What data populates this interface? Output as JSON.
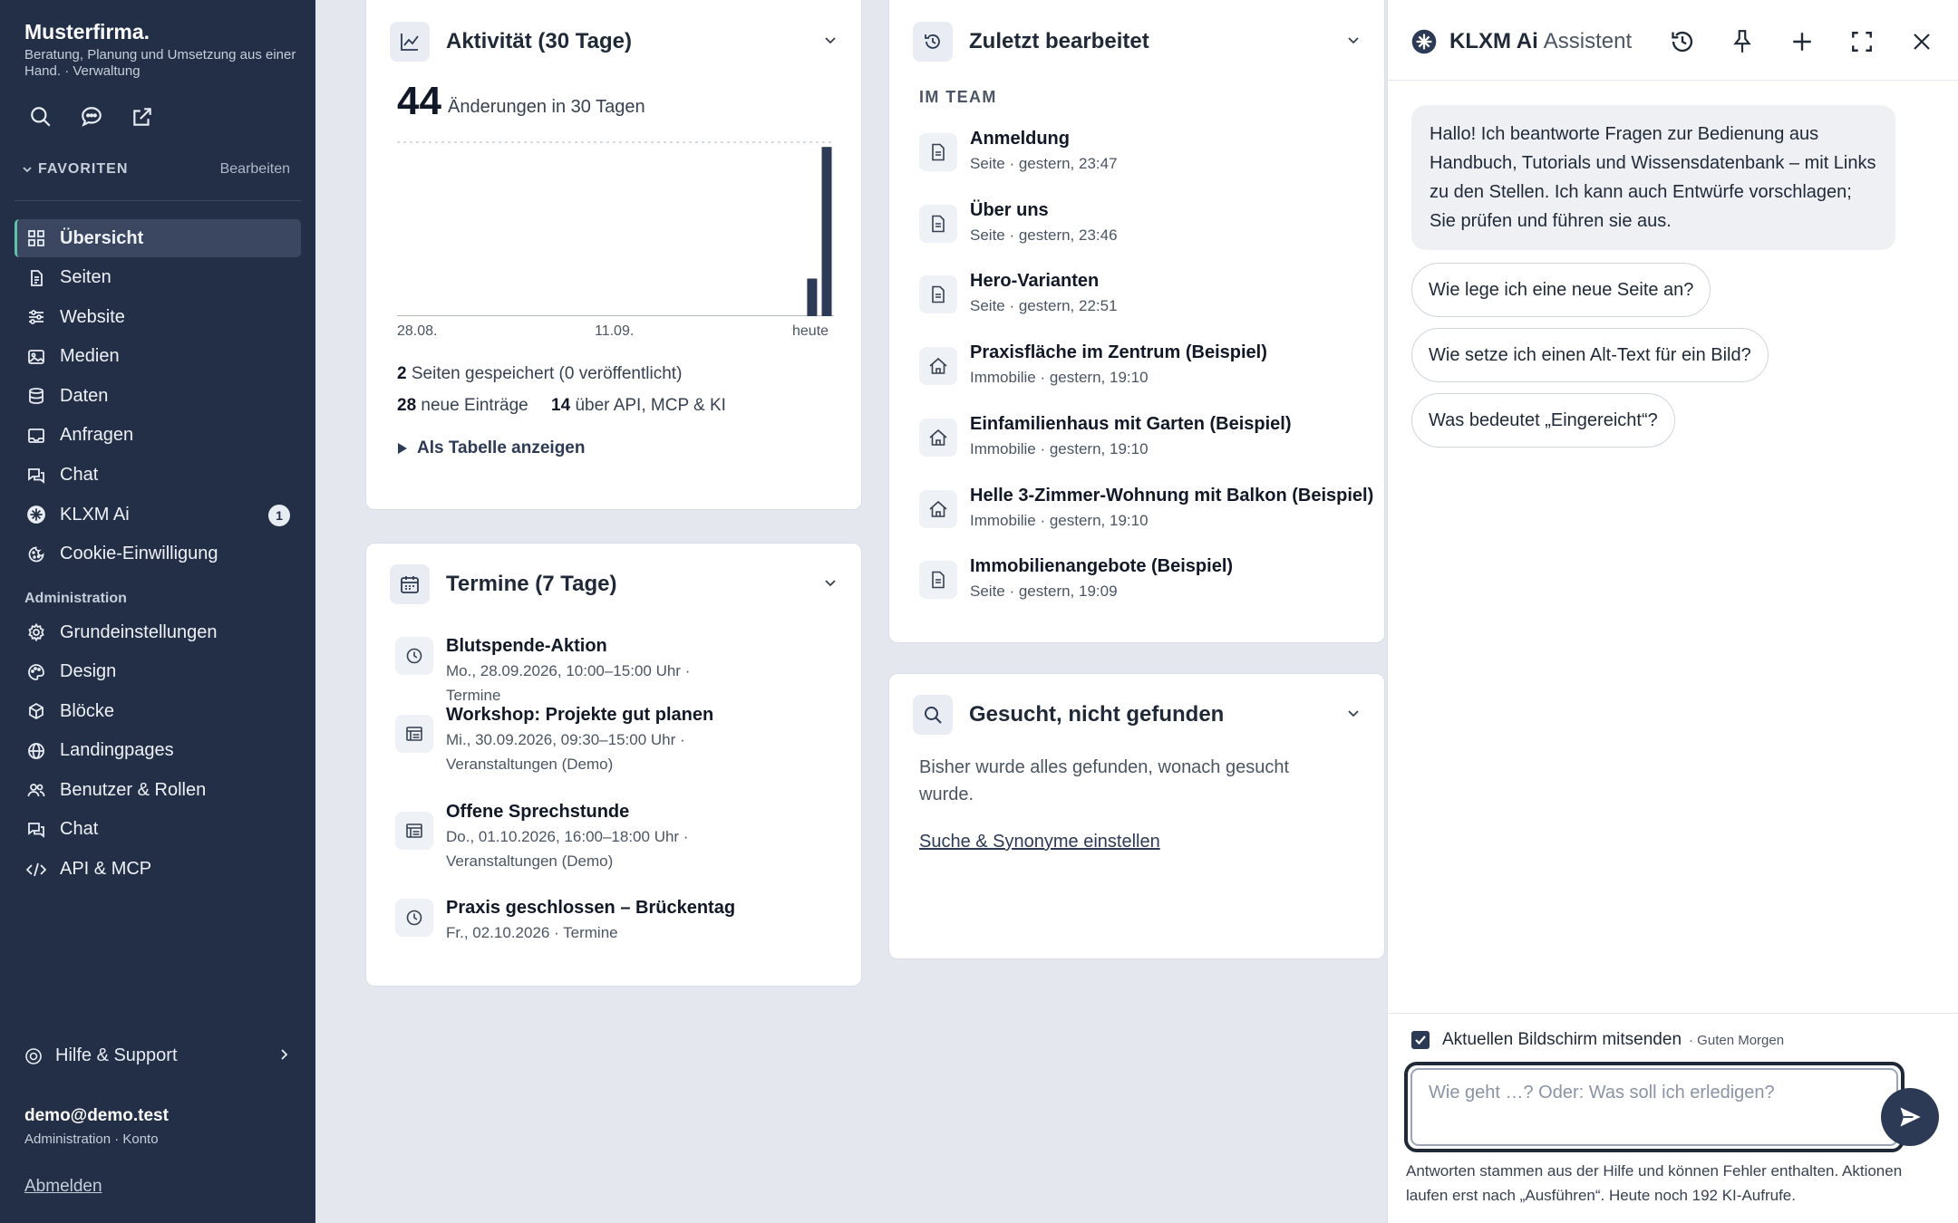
{
  "sidebar": {
    "brand": "Musterfirma.",
    "tagline": "Beratung, Planung und Umsetzung aus einer Hand. · Verwaltung",
    "favorites_label": "FAVORITEN",
    "favorites_edit": "Bearbeiten",
    "nav": [
      {
        "label": "Übersicht",
        "icon": "grid-icon"
      },
      {
        "label": "Seiten",
        "icon": "pages-icon"
      },
      {
        "label": "Website",
        "icon": "sliders-icon"
      },
      {
        "label": "Medien",
        "icon": "image-icon"
      },
      {
        "label": "Daten",
        "icon": "database-icon"
      },
      {
        "label": "Anfragen",
        "icon": "inbox-icon"
      },
      {
        "label": "Chat",
        "icon": "chat-icon"
      },
      {
        "label": "KLXM Ai",
        "icon": "ai-icon",
        "badge": "1"
      },
      {
        "label": "Cookie-Einwilligung",
        "icon": "cookie-icon"
      }
    ],
    "admin_label": "Administration",
    "admin_nav": [
      {
        "label": "Grundeinstellungen",
        "icon": "gear-icon"
      },
      {
        "label": "Design",
        "icon": "palette-icon"
      },
      {
        "label": "Blöcke",
        "icon": "cube-icon"
      },
      {
        "label": "Landingpages",
        "icon": "globe-icon"
      },
      {
        "label": "Benutzer & Rollen",
        "icon": "users-icon"
      },
      {
        "label": "Chat",
        "icon": "chat-icon"
      },
      {
        "label": "API & MCP",
        "icon": "code-icon"
      }
    ],
    "help": "Hilfe & Support",
    "user_email": "demo@demo.test",
    "user_role": "Administration · Konto",
    "logout": "Abmelden"
  },
  "activity": {
    "title": "Aktivität (30 Tage)",
    "count": "44",
    "count_label": "Änderungen in 30 Tagen",
    "axis_labels": [
      "28.08.",
      "11.09.",
      "heute"
    ],
    "saved_count": "2",
    "saved_text": "Seiten gespeichert (0 veröffentlicht)",
    "new_count": "28",
    "new_text": "neue Einträge",
    "api_count": "14",
    "api_text": "über API, MCP & KI",
    "table_toggle": "Als Tabelle anzeigen"
  },
  "chart_data": {
    "type": "bar",
    "title": "Aktivität (30 Tage)",
    "x_tick_labels": [
      "28.08.",
      "11.09.",
      "heute"
    ],
    "values": [
      0,
      0,
      0,
      0,
      0,
      0,
      0,
      0,
      0,
      0,
      0,
      0,
      0,
      0,
      0,
      0,
      0,
      0,
      0,
      0,
      0,
      0,
      0,
      0,
      0,
      0,
      0,
      0,
      8,
      36
    ],
    "ylim": [
      0,
      37
    ],
    "grid": false
  },
  "appointments": {
    "title": "Termine (7 Tage)",
    "items": [
      {
        "title": "Blutspende-Aktion",
        "sub": "Mo., 28.09.2026, 10:00–15:00 Uhr · Termine",
        "icon": "clock-icon"
      },
      {
        "title": "Workshop: Projekte gut planen",
        "sub": "Mi., 30.09.2026, 09:30–15:00 Uhr · Veranstaltungen (Demo)",
        "icon": "list-icon"
      },
      {
        "title": "Offene Sprechstunde",
        "sub": "Do., 01.10.2026, 16:00–18:00 Uhr · Veranstaltungen (Demo)",
        "icon": "list-icon"
      },
      {
        "title": "Praxis geschlossen – Brückentag",
        "sub": "Fr., 02.10.2026 · Termine",
        "icon": "clock-icon"
      }
    ]
  },
  "recent": {
    "title": "Zuletzt bearbeitet",
    "team_label": "IM TEAM",
    "items": [
      {
        "title": "Anmeldung",
        "sub": "Seite · gestern, 23:47",
        "icon": "page-icon"
      },
      {
        "title": "Über uns",
        "sub": "Seite · gestern, 23:46",
        "icon": "page-icon"
      },
      {
        "title": "Hero-Varianten",
        "sub": "Seite · gestern, 22:51",
        "icon": "page-icon"
      },
      {
        "title": "Praxisfläche im Zentrum (Beispiel)",
        "sub": "Immobilie · gestern, 19:10",
        "icon": "house-icon"
      },
      {
        "title": "Einfamilienhaus mit Garten (Beispiel)",
        "sub": "Immobilie · gestern, 19:10",
        "icon": "house-icon"
      },
      {
        "title": "Helle 3-Zimmer-Wohnung mit Balkon (Beispiel)",
        "sub": "Immobilie · gestern, 19:10",
        "icon": "house-icon"
      },
      {
        "title": "Immobilienangebote (Beispiel)",
        "sub": "Seite · gestern, 19:09",
        "icon": "page-icon"
      }
    ]
  },
  "notfound": {
    "title": "Gesucht, nicht gefunden",
    "text": "Bisher wurde alles gefunden, wonach gesucht wurde.",
    "link": "Suche & Synonyme einstellen"
  },
  "assistant": {
    "title": "KLXM Ai",
    "subtitle": "Assistent",
    "greeting": "Hallo! Ich beantworte Fragen zur Bedienung aus Handbuch, Tutorials und Wissensdatenbank – mit Links zu den Stellen. Ich kann auch Entwürfe vorschlagen; Sie prüfen und führen sie aus.",
    "suggestions": [
      "Wie lege ich eine neue Seite an?",
      "Wie setze ich einen Alt-Text für ein Bild?",
      "Was bedeutet „Eingereicht“?"
    ],
    "context_label": "Aktuellen Bildschirm mitsenden",
    "greeting_tag": "· Guten Morgen",
    "input_placeholder": "Wie geht …? Oder: Was soll ich erledigen?",
    "disclaimer": "Antworten stammen aus der Hilfe und können Fehler enthalten. Aktionen laufen erst nach „Ausführen“. Heute noch 192 KI-Aufrufe."
  },
  "colors": {
    "sidebar": "#232f47",
    "accent": "#2d3a55",
    "active_marker": "#5fc3a8"
  }
}
